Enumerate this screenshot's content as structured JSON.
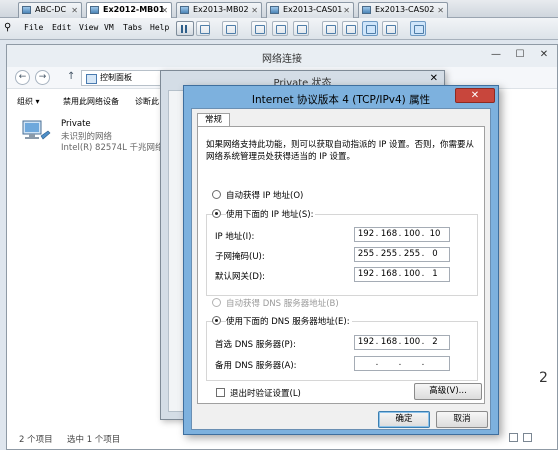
{
  "vm_tabs": [
    {
      "label": "ABC-DC",
      "active": false
    },
    {
      "label": "Ex2012-MB01",
      "active": true
    },
    {
      "label": "Ex2013-MB02",
      "active": false
    },
    {
      "label": "Ex2013-CAS01",
      "active": false
    },
    {
      "label": "Ex2013-CAS02",
      "active": false
    }
  ],
  "vm_menu": [
    "File",
    "Edit",
    "View",
    "VM",
    "Tabs",
    "Help"
  ],
  "netwin": {
    "title": "网络连接",
    "breadcrumb": "控制面板",
    "commands": [
      "组织 ▾",
      "禁用此网络设备",
      "诊断此"
    ],
    "adapter": {
      "name": "Private",
      "status": "未识别的网络",
      "device": "Intel(R) 82574L 千兆网络连"
    },
    "status_count": "2 个项目",
    "status_selected": "选中 1 个项目"
  },
  "privwin": {
    "title": "Private 状态"
  },
  "ipv4": {
    "title": "Internet 协议版本 4 (TCP/IPv4) 属性",
    "tab": "常规",
    "description": "如果网络支持此功能，则可以获取自动指派的 IP 设置。否则，你需要从网络系统管理员处获得适当的 IP 设置。",
    "auto_ip_label": "自动获得 IP 地址(O)",
    "manual_ip_label": "使用下面的 IP 地址(S):",
    "ip_label": "IP 地址(I):",
    "ip_value": [
      "192",
      "168",
      "100",
      "10"
    ],
    "mask_label": "子网掩码(U):",
    "mask_value": [
      "255",
      "255",
      "255",
      "0"
    ],
    "gateway_label": "默认网关(D):",
    "gateway_value": [
      "192",
      "168",
      "100",
      "1"
    ],
    "auto_dns_label": "自动获得 DNS 服务器地址(B)",
    "manual_dns_label": "使用下面的 DNS 服务器地址(E):",
    "preferred_dns_label": "首选 DNS 服务器(P):",
    "preferred_dns_value": [
      "192",
      "168",
      "100",
      "2"
    ],
    "alternate_dns_label": "备用 DNS 服务器(A):",
    "alternate_dns_value": [
      "",
      "",
      "",
      ""
    ],
    "validate_label": "退出时验证设置(L)",
    "advanced_label": "高级(V)...",
    "ok_label": "确定",
    "cancel_label": "取消",
    "ip_mode": "manual",
    "dns_mode": "manual",
    "validate_checked": false
  },
  "edge_text": "2",
  "icons": [
    "pause-icon",
    "network-adapter-icon",
    "back-arrow-icon",
    "forward-arrow-icon",
    "up-arrow-icon",
    "close-icon"
  ]
}
